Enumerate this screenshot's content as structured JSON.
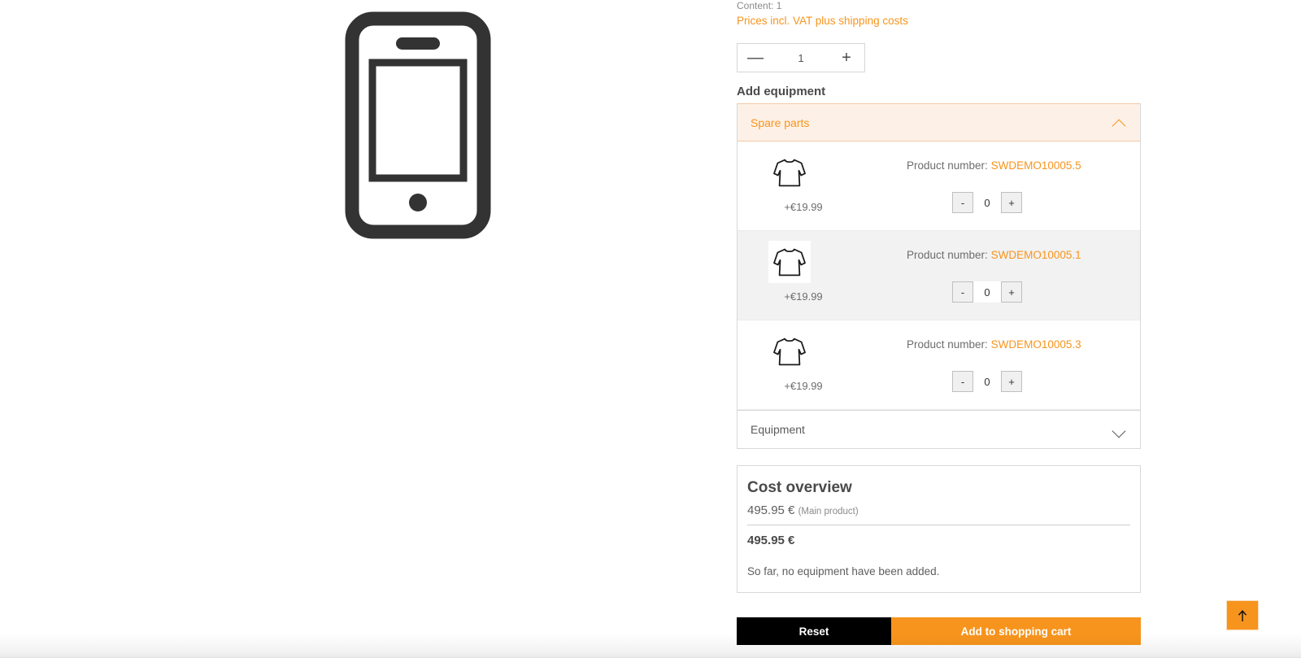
{
  "product": {
    "content_label": "Content: 1",
    "vat_note": "Prices incl. VAT plus shipping costs",
    "quantity": {
      "decrement": "—",
      "value": "1",
      "increment": "+"
    },
    "gallery_image_alt": "smartphone-illustration"
  },
  "equipment": {
    "section_title": "Add equipment",
    "groups": [
      {
        "label": "Spare parts",
        "state": "open",
        "chevron": "chevron-up-icon"
      },
      {
        "label": "Equipment",
        "state": "closed",
        "chevron": "chevron-down-icon"
      }
    ],
    "product_number_label": "Product number:",
    "decrement_label": "-",
    "increment_label": "+",
    "items": [
      {
        "thumb": "longsleeve-shirt-icon",
        "price": "+€19.99",
        "product_number": "SWDEMO10005.5",
        "quantity": "0",
        "hovered": false
      },
      {
        "thumb": "longsleeve-shirt-icon",
        "price": "+€19.99",
        "product_number": "SWDEMO10005.1",
        "quantity": "0",
        "hovered": true
      },
      {
        "thumb": "longsleeve-shirt-icon",
        "price": "+€19.99",
        "product_number": "SWDEMO10005.3",
        "quantity": "0",
        "hovered": false
      }
    ]
  },
  "cost_overview": {
    "title": "Cost overview",
    "main_amount": "495.95 €",
    "main_label": "(Main product)",
    "total": "495.95 €",
    "note": "So far, no equipment have been added."
  },
  "actions": {
    "reset": "Reset",
    "add_to_cart": "Add to shopping cart"
  },
  "scroll_top": {
    "icon": "arrow-up-icon"
  },
  "colors": {
    "accent": "#f7941d",
    "accent_bg": "#fdf1e7",
    "accent_border": "#f5c9a4",
    "text": "#4a4a4a",
    "muted": "#8a8a8a",
    "row_hover": "#f2f2f2",
    "black": "#000000"
  }
}
